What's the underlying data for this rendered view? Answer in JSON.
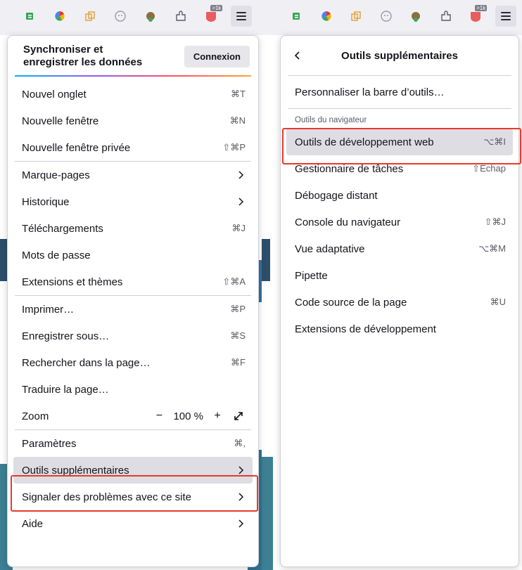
{
  "toolbar": {
    "icons": [
      "extension-e-icon",
      "color-wheel-icon",
      "copy-icon",
      "ghost-icon",
      "bird-icon",
      "puzzle-icon",
      "badge-icon",
      "menu-icon"
    ],
    "badge_text": ">1k"
  },
  "main_menu": {
    "sync_title": "Synchroniser et enregistrer les données",
    "sync_line1": "Synchroniser et",
    "sync_line2": "enregistrer les données",
    "connexion_label": "Connexion",
    "groups": [
      [
        {
          "label": "Nouvel onglet",
          "shortcut": "⌘T"
        },
        {
          "label": "Nouvelle fenêtre",
          "shortcut": "⌘N"
        },
        {
          "label": "Nouvelle fenêtre privée",
          "shortcut": "⇧⌘P"
        }
      ],
      [
        {
          "label": "Marque-pages",
          "shortcut": ">"
        },
        {
          "label": "Historique",
          "shortcut": ">"
        },
        {
          "label": "Téléchargements",
          "shortcut": "⌘J"
        },
        {
          "label": "Mots de passe",
          "shortcut": ""
        },
        {
          "label": "Extensions et thèmes",
          "shortcut": "⇧⌘A"
        }
      ],
      [
        {
          "label": "Imprimer…",
          "shortcut": "⌘P"
        },
        {
          "label": "Enregistrer sous…",
          "shortcut": "⌘S"
        },
        {
          "label": "Rechercher dans la page…",
          "shortcut": "⌘F"
        },
        {
          "label": "Traduire la page…",
          "shortcut": ""
        }
      ]
    ],
    "zoom": {
      "label": "Zoom",
      "minus": "−",
      "value": "100 %",
      "plus": "+"
    },
    "bottom": [
      {
        "label": "Paramètres",
        "shortcut": "⌘,"
      },
      {
        "label": "Outils supplémentaires",
        "shortcut": ">"
      },
      {
        "label": "Signaler des problèmes avec ce site",
        "shortcut": ">"
      },
      {
        "label": "Aide",
        "shortcut": ">"
      }
    ]
  },
  "sub_menu": {
    "title": "Outils supplémentaires",
    "customize": "Personnaliser la barre d’outils…",
    "section": "Outils du navigateur",
    "items": [
      {
        "label": "Outils de développement web",
        "shortcut": "⌥⌘I"
      },
      {
        "label": "Gestionnaire de tâches",
        "shortcut": "⇧Échap"
      },
      {
        "label": "Débogage distant",
        "shortcut": ""
      },
      {
        "label": "Console du navigateur",
        "shortcut": "⇧⌘J"
      },
      {
        "label": "Vue adaptative",
        "shortcut": "⌥⌘M"
      },
      {
        "label": "Pipette",
        "shortcut": ""
      },
      {
        "label": "Code source de la page",
        "shortcut": "⌘U"
      },
      {
        "label": "Extensions de développement",
        "shortcut": ""
      }
    ]
  },
  "colors": {
    "highlight": "#dddde3",
    "annotation": "#e8392b"
  }
}
